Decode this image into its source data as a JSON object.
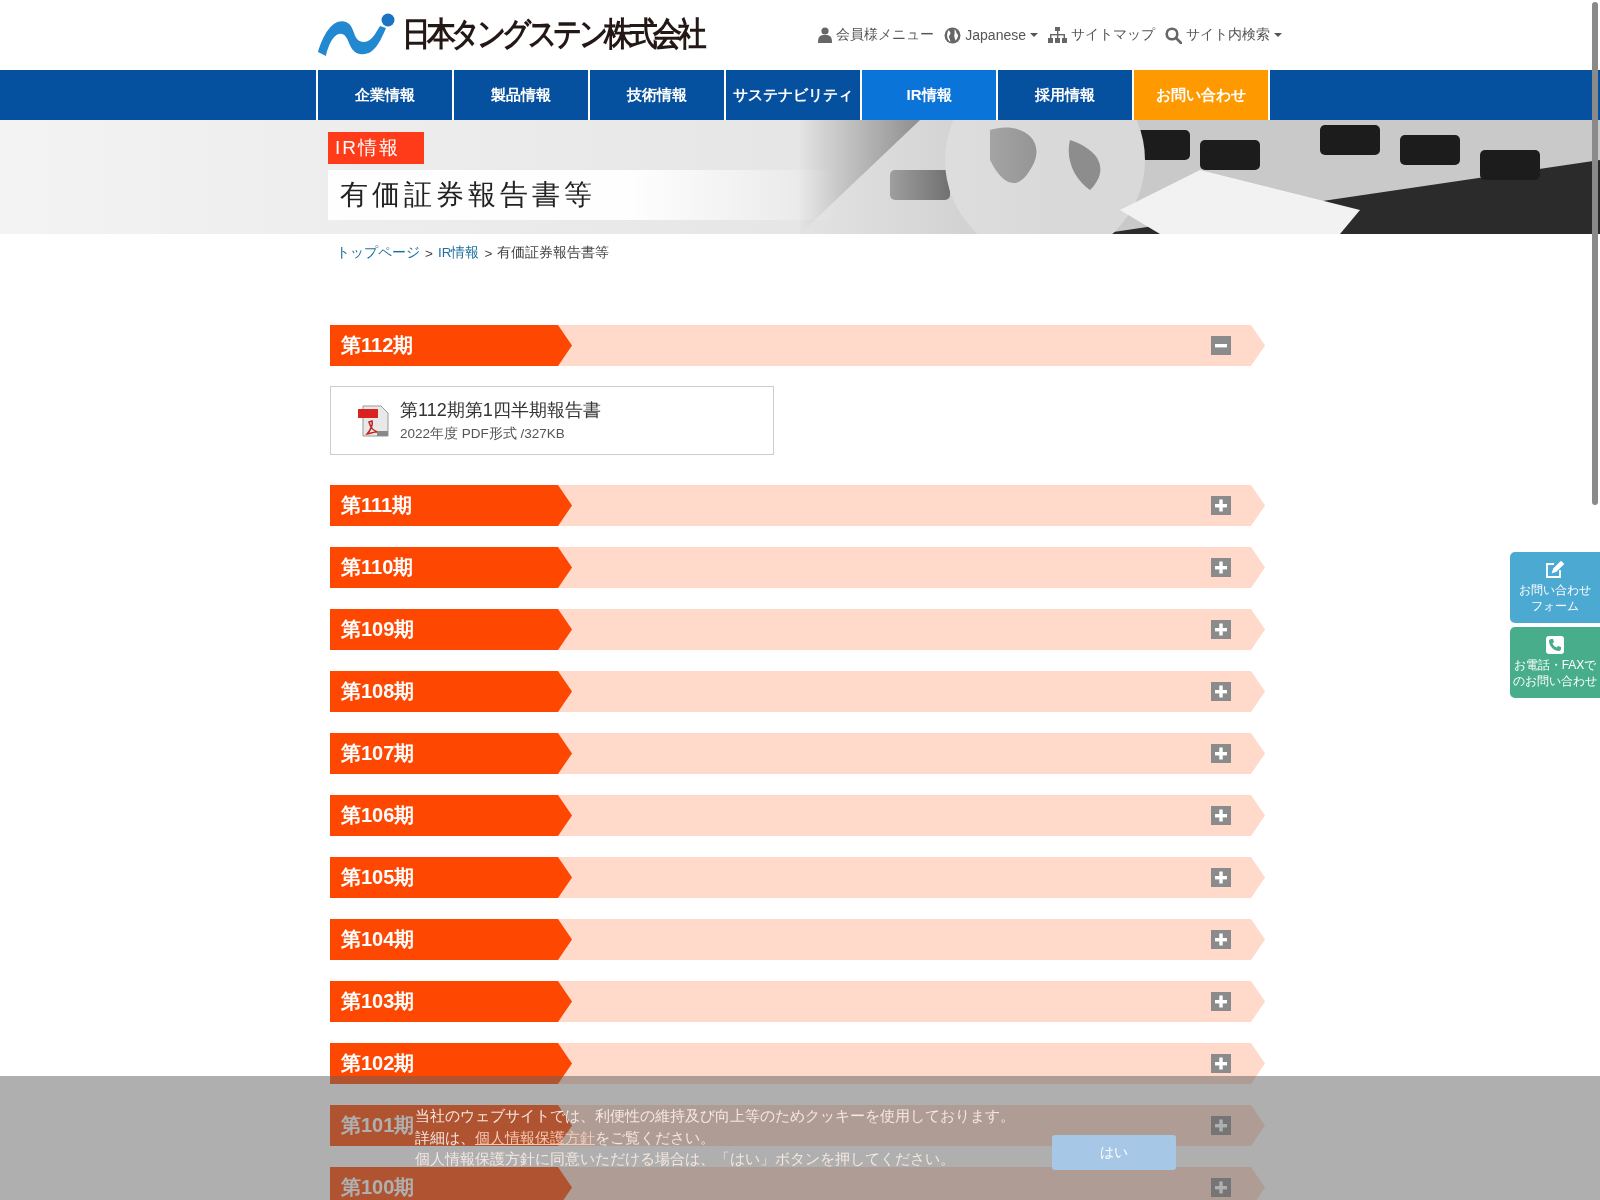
{
  "header": {
    "logo_text": "日本タングステン株式会社",
    "links": [
      {
        "label": "会員様メニュー",
        "has_menu": false
      },
      {
        "label": "Japanese",
        "has_menu": true
      },
      {
        "label": "サイトマップ",
        "has_menu": false
      },
      {
        "label": "サイト内検索",
        "has_menu": true
      }
    ]
  },
  "nav": [
    {
      "label": "企業情報",
      "selected": false,
      "kind": "normal"
    },
    {
      "label": "製品情報",
      "selected": false,
      "kind": "normal"
    },
    {
      "label": "技術情報",
      "selected": false,
      "kind": "normal"
    },
    {
      "label": "サステナビリティ",
      "selected": false,
      "kind": "normal"
    },
    {
      "label": "IR情報",
      "selected": true,
      "kind": "normal"
    },
    {
      "label": "採用情報",
      "selected": false,
      "kind": "normal"
    },
    {
      "label": "お問い合わせ",
      "selected": false,
      "kind": "contact"
    }
  ],
  "banner": {
    "category": "IR情報",
    "title": "有価証券報告書等"
  },
  "breadcrumb": [
    {
      "label": "トップページ",
      "kind": "link"
    },
    {
      "label": ">",
      "kind": "separator"
    },
    {
      "label": "IR情報",
      "kind": "link"
    },
    {
      "label": ">",
      "kind": "separator"
    },
    {
      "label": "有価証券報告書等",
      "kind": "current"
    }
  ],
  "periods": [
    {
      "label": "第112期",
      "expanded": true,
      "documents": [
        {
          "title": "第112期第1四半期報告書",
          "meta": "2022年度 PDF形式 /327KB"
        }
      ]
    },
    {
      "label": "第111期",
      "expanded": false
    },
    {
      "label": "第110期",
      "expanded": false
    },
    {
      "label": "第109期",
      "expanded": false
    },
    {
      "label": "第108期",
      "expanded": false
    },
    {
      "label": "第107期",
      "expanded": false
    },
    {
      "label": "第106期",
      "expanded": false
    },
    {
      "label": "第105期",
      "expanded": false
    },
    {
      "label": "第104期",
      "expanded": false
    },
    {
      "label": "第103期",
      "expanded": false
    },
    {
      "label": "第102期",
      "expanded": false
    },
    {
      "label": "第101期",
      "expanded": false
    },
    {
      "label": "第100期",
      "expanded": false
    }
  ],
  "side_buttons": [
    {
      "lines": [
        "お問い合わせ",
        "フォーム"
      ],
      "color": "#4ca9d1"
    },
    {
      "lines": [
        "お電話・FAXで",
        "のお問い合わせ"
      ],
      "color": "#48ad8b"
    }
  ],
  "cookie": {
    "line1": "当社のウェブサイトでは、利便性の維持及び向上等のためクッキーを使用しております。",
    "line2_before": "詳細は、",
    "line2_link": "個人情報保護方針",
    "line2_after": "をご覧ください。",
    "line3": "個人情報保護方針に同意いただける場合は、「はい」ボタンを押してください。",
    "button": "はい"
  }
}
